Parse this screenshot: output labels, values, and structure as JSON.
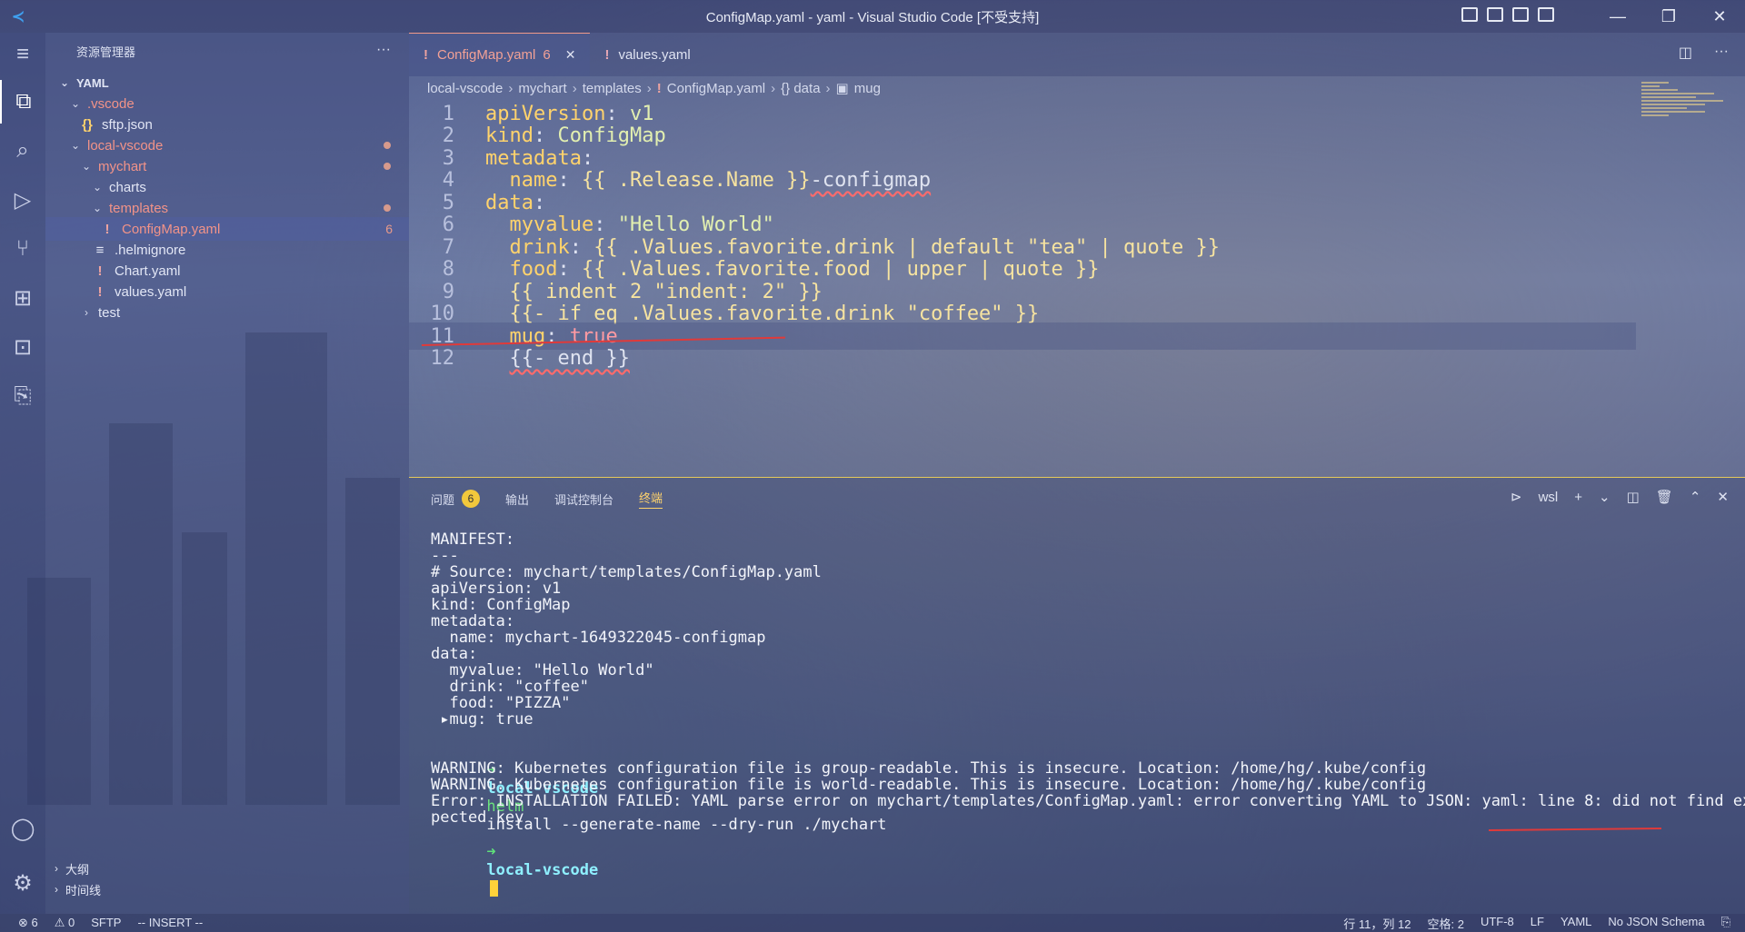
{
  "window": {
    "title": "ConfigMap.yaml - yaml - Visual Studio Code [不受支持]",
    "logo": "vscode-logo",
    "min": "—",
    "max": "❐",
    "close": "✕"
  },
  "activity": {
    "menu": "≡",
    "explorer": "⧉",
    "search": "⌕",
    "run": "▷",
    "scm": "⑂",
    "extensions": "⊞",
    "remote": "⊡",
    "sftp": "⎘",
    "account": "◯",
    "settings": "⚙"
  },
  "sidebar": {
    "header": "资源管理器",
    "more": "···",
    "root": "YAML",
    "items": [
      {
        "label": ".vscode",
        "chev": "⌄",
        "icon": ""
      },
      {
        "label": "sftp.json",
        "chev": "",
        "icon": "{}"
      },
      {
        "label": "local-vscode",
        "chev": "⌄",
        "icon": ""
      },
      {
        "label": "mychart",
        "chev": "⌄",
        "icon": ""
      },
      {
        "label": "charts",
        "chev": "⌄",
        "icon": ""
      },
      {
        "label": "templates",
        "chev": "⌄",
        "icon": ""
      },
      {
        "label": "ConfigMap.yaml",
        "chev": "",
        "icon": "!",
        "badge": "6"
      },
      {
        "label": ".helmignore",
        "chev": "",
        "icon": "≡"
      },
      {
        "label": "Chart.yaml",
        "chev": "",
        "icon": "!"
      },
      {
        "label": "values.yaml",
        "chev": "",
        "icon": "!"
      },
      {
        "label": "test",
        "chev": "›",
        "icon": ""
      }
    ],
    "outline": "大纲",
    "timeline": "时间线"
  },
  "editor": {
    "tabs": [
      {
        "label": "ConfigMap.yaml",
        "count": "6",
        "close": "✕"
      },
      {
        "label": "values.yaml"
      }
    ],
    "breadcrumb": [
      "local-vscode",
      "mychart",
      "templates",
      "ConfigMap.yaml",
      "{} data",
      "mug"
    ],
    "breadcrumb_icons": {
      "file": "!",
      "mug": "▣"
    },
    "actions": {
      "split": "◫",
      "more": "···"
    },
    "lines": [
      {
        "n": "1",
        "parts": [
          [
            "k",
            "apiVersion"
          ],
          [
            "p",
            ": "
          ],
          [
            "s",
            "v1"
          ]
        ]
      },
      {
        "n": "2",
        "parts": [
          [
            "k",
            "kind"
          ],
          [
            "p",
            ": "
          ],
          [
            "s",
            "ConfigMap"
          ]
        ]
      },
      {
        "n": "3",
        "parts": [
          [
            "k",
            "metadata"
          ],
          [
            "p",
            ":"
          ]
        ]
      },
      {
        "n": "4",
        "parts": [
          [
            "p",
            "  "
          ],
          [
            "k",
            "name"
          ],
          [
            "p",
            ": "
          ],
          [
            "t",
            "{{ .Release.Name }}"
          ],
          [
            "sq",
            "-configmap"
          ]
        ]
      },
      {
        "n": "5",
        "parts": [
          [
            "k",
            "data"
          ],
          [
            "p",
            ":"
          ]
        ]
      },
      {
        "n": "6",
        "parts": [
          [
            "p",
            "  "
          ],
          [
            "k",
            "myvalue"
          ],
          [
            "p",
            ": "
          ],
          [
            "s",
            "\"Hello World\""
          ]
        ]
      },
      {
        "n": "7",
        "parts": [
          [
            "p",
            "  "
          ],
          [
            "k",
            "drink"
          ],
          [
            "p",
            ": "
          ],
          [
            "t",
            "{{ .Values.favorite.drink | default \"tea\" | quote }}"
          ]
        ]
      },
      {
        "n": "8",
        "parts": [
          [
            "p",
            "  "
          ],
          [
            "k",
            "food"
          ],
          [
            "p",
            ": "
          ],
          [
            "t",
            "{{ .Values.favorite.food | upper | quote }}"
          ]
        ]
      },
      {
        "n": "9",
        "parts": [
          [
            "p",
            "  "
          ],
          [
            "t",
            "{{ indent 2 \"indent: 2\" }}"
          ]
        ]
      },
      {
        "n": "10",
        "parts": [
          [
            "p",
            "  "
          ],
          [
            "t",
            "{{- if eq .Values.favorite.drink \"coffee\" }}"
          ]
        ]
      },
      {
        "n": "11",
        "parts": [
          [
            "p",
            "  "
          ],
          [
            "k",
            "mug"
          ],
          [
            "p",
            ": "
          ],
          [
            "b",
            "true"
          ]
        ]
      },
      {
        "n": "12",
        "parts": [
          [
            "p",
            "  "
          ],
          [
            "sq",
            "{{- end }}"
          ]
        ]
      }
    ]
  },
  "panel": {
    "tabs": [
      "问题",
      "输出",
      "调试控制台",
      "终端"
    ],
    "problems_count": "6",
    "shell": "wsl",
    "actions": {
      "shell_icon": "⊳",
      "add": "+",
      "dropdown": "⌄",
      "split": "◫",
      "kill": "🗑",
      "maximize": "⌃",
      "close": "✕"
    },
    "terminal": [
      "MANIFEST:",
      "---",
      "# Source: mychart/templates/ConfigMap.yaml",
      "apiVersion: v1",
      "kind: ConfigMap",
      "metadata:",
      "  name: mychart-1649322045-configmap",
      "data:",
      "  myvalue: \"Hello World\"",
      "  drink: \"coffee\"",
      "  food: \"PIZZA\"",
      " ▸mug: true",
      "",
      "",
      "WARNING: Kubernetes configuration file is group-readable. This is insecure. Location: /home/hg/.kube/config",
      "WARNING: Kubernetes configuration file is world-readable. This is insecure. Location: /home/hg/.kube/config",
      "Error: INSTALLATION FAILED: YAML parse error on mychart/templates/ConfigMap.yaml: error converting YAML to JSON: yaml: line 8: did not find ex",
      "pected key"
    ],
    "prompt_arrow": "➜",
    "prompt_cwd": "local-vscode",
    "prompt_cmd": "helm",
    "prompt_args": "install --generate-name --dry-run ./mychart"
  },
  "status": {
    "errors": "⊗ 6",
    "warnings": "⚠ 0",
    "sftp": "SFTP",
    "mode": "-- INSERT --",
    "position": "行 11，列 12",
    "indent": "空格: 2",
    "encoding": "UTF-8",
    "eol": "LF",
    "language": "YAML",
    "schema": "No JSON Schema",
    "feedback": "⎘"
  }
}
